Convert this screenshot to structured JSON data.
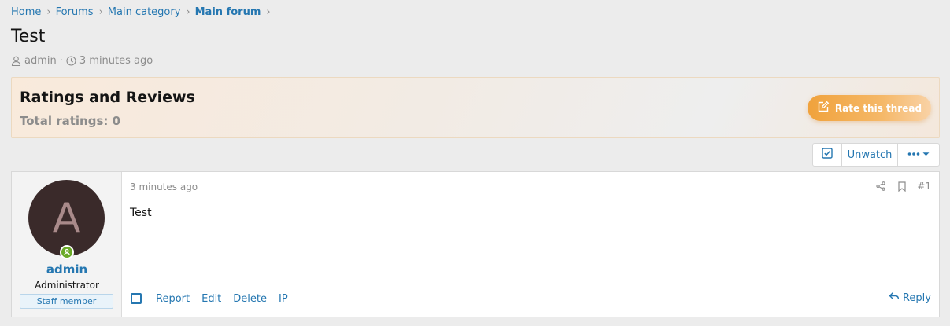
{
  "breadcrumb": {
    "items": [
      "Home",
      "Forums",
      "Main category",
      "Main forum"
    ],
    "separator": "›"
  },
  "thread": {
    "title": "Test",
    "author": "admin",
    "meta_separator": "·",
    "time": "3 minutes ago"
  },
  "ratings": {
    "title": "Ratings and Reviews",
    "total": "Total ratings: 0",
    "rate_button": "Rate this thread"
  },
  "actions": {
    "unwatch": "Unwatch"
  },
  "post": {
    "avatar_letter": "A",
    "username": "admin",
    "user_title": "Administrator",
    "staff_badge": "Staff member",
    "date": "3 minutes ago",
    "number": "#1",
    "body": "Test",
    "footer_links": [
      "Report",
      "Edit",
      "Delete",
      "IP"
    ],
    "reply": "Reply"
  },
  "colors": {
    "link": "#2577b1",
    "muted": "#8c8c8c",
    "accent_orange": "#f0a23c",
    "online_green": "#6aaa28",
    "avatar_bg": "#3a2a2a"
  },
  "icons": {
    "meta_author": "user-icon",
    "meta_time": "clock-icon",
    "rate": "edit-icon",
    "select_all": "checkbox-icon",
    "more": "more-dots-icon",
    "share": "share-icon",
    "bookmark": "bookmark-icon",
    "reply": "reply-icon",
    "online": "online-user-icon"
  }
}
